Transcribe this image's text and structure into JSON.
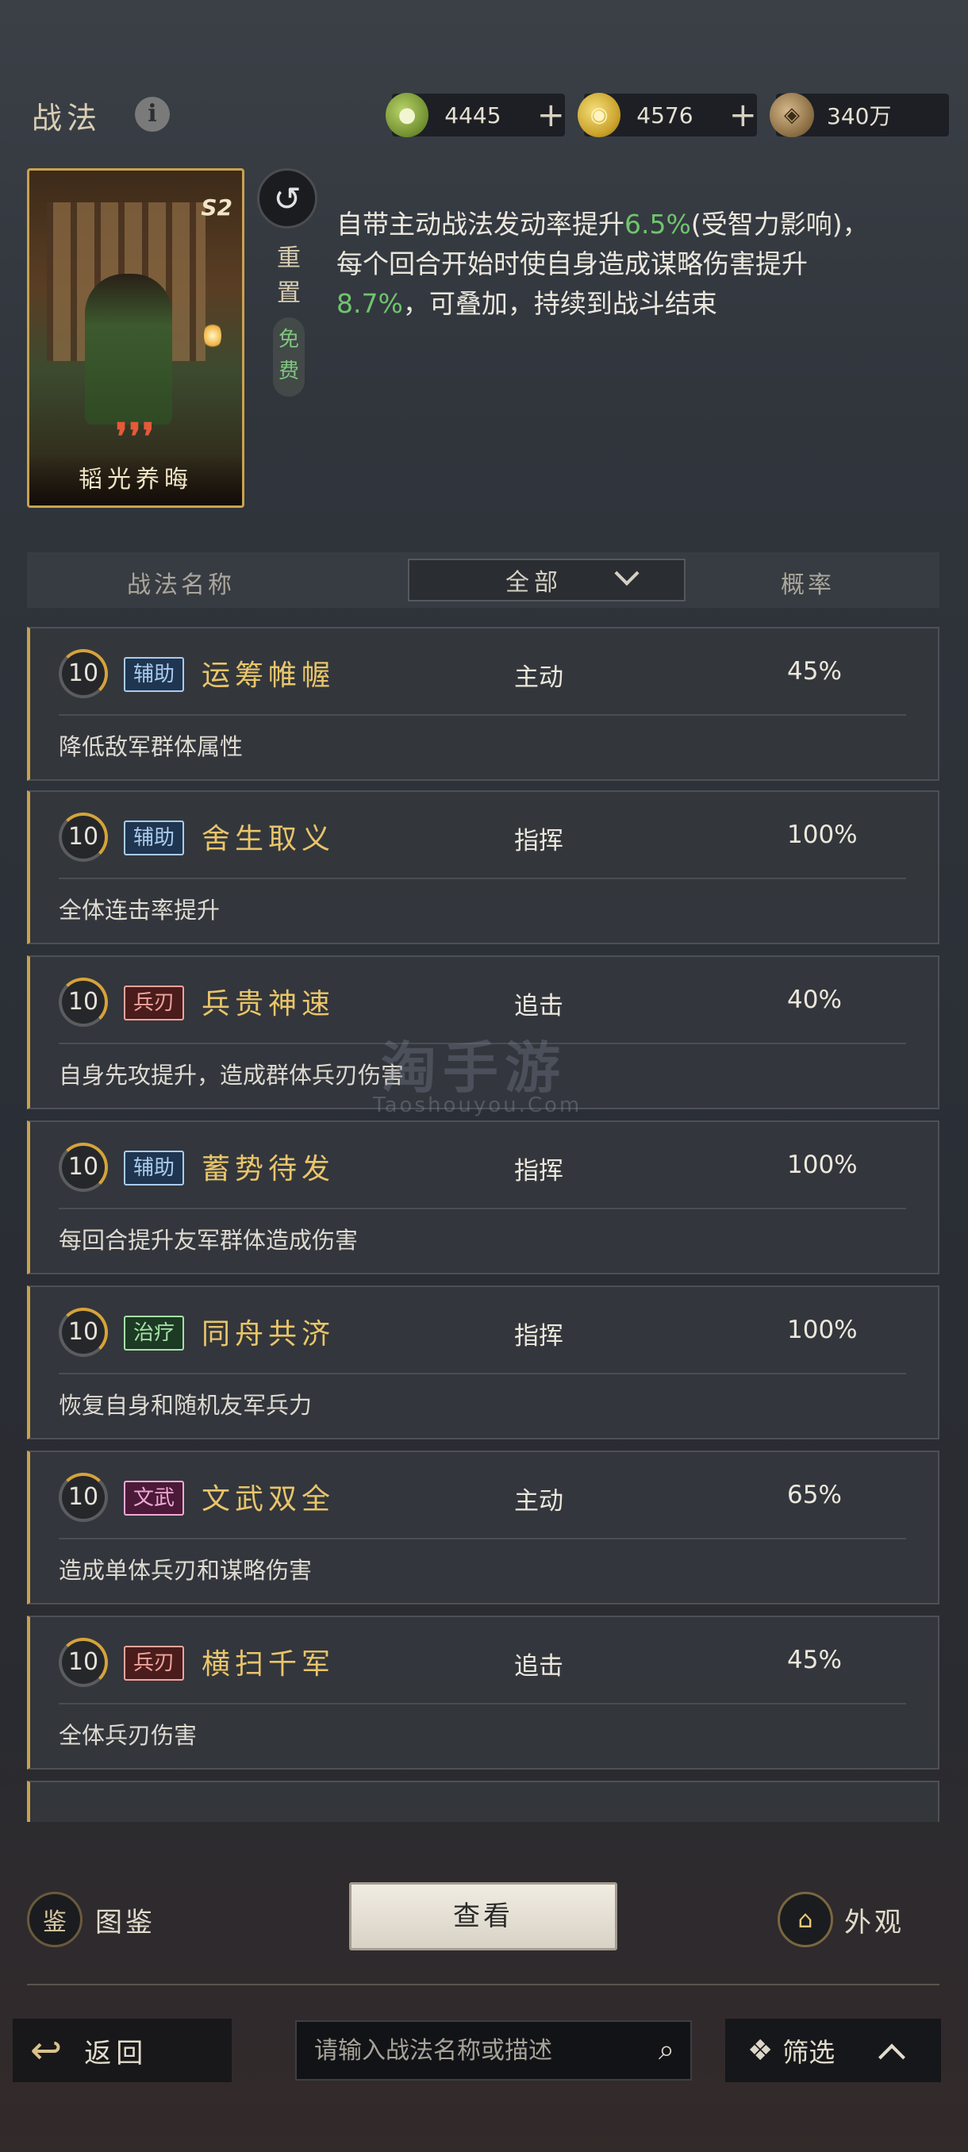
{
  "header": {
    "title": "战法",
    "info_icon": "i",
    "currencies": [
      {
        "name": "jade",
        "icon": "jade-coin-icon",
        "value": "4445"
      },
      {
        "name": "gold",
        "icon": "gold-coin-icon",
        "value": "4576"
      },
      {
        "name": "copper",
        "icon": "copper-coin-icon",
        "value": "340万"
      }
    ],
    "plus_label": "+"
  },
  "selected": {
    "card_name": "韬光养晦",
    "season_badge": "S2",
    "grade_marks": "❜❜❜",
    "reset_label": "重置",
    "free_label": "免费",
    "desc_part1": "自带主动战法发动率提升",
    "desc_value1": "6.5%",
    "desc_part2": "(受智力影响)，每个回合开始时使自身造成谋略伤害提升",
    "desc_value2": "8.7%",
    "desc_part3": "，可叠加，持续到战斗结束"
  },
  "filter": {
    "col_name": "战法名称",
    "dropdown_value": "全部",
    "col_rate": "概率"
  },
  "skills": [
    {
      "level": "10",
      "tag": "辅助",
      "tag_type": "assist",
      "name": "运筹帷幄",
      "type": "主动",
      "rate": "45%",
      "desc": "降低敌军群体属性"
    },
    {
      "level": "10",
      "tag": "辅助",
      "tag_type": "assist",
      "name": "舍生取义",
      "type": "指挥",
      "rate": "100%",
      "desc": "全体连击率提升"
    },
    {
      "level": "10",
      "tag": "兵刃",
      "tag_type": "blade",
      "name": "兵贵神速",
      "type": "追击",
      "rate": "40%",
      "desc": "自身先攻提升，造成群体兵刃伤害"
    },
    {
      "level": "10",
      "tag": "辅助",
      "tag_type": "assist",
      "name": "蓄势待发",
      "type": "指挥",
      "rate": "100%",
      "desc": "每回合提升友军群体造成伤害"
    },
    {
      "level": "10",
      "tag": "治疗",
      "tag_type": "heal",
      "name": "同舟共济",
      "type": "指挥",
      "rate": "100%",
      "desc": "恢复自身和随机友军兵力"
    },
    {
      "level": "10",
      "tag": "文武",
      "tag_type": "civil",
      "name": "文武双全",
      "type": "主动",
      "rate": "65%",
      "desc": "造成单体兵刃和谋略伤害"
    },
    {
      "level": "10",
      "tag": "兵刃",
      "tag_type": "blade",
      "name": "横扫千军",
      "type": "追击",
      "rate": "45%",
      "desc": "全体兵刃伤害"
    }
  ],
  "watermark": {
    "main": "淘手游",
    "sub": "Taoshouyou.Com"
  },
  "actions": {
    "book_label": "图鉴",
    "view_label": "查看",
    "appearance_label": "外观"
  },
  "footer": {
    "back_label": "返回",
    "search_placeholder": "请输入战法名称或描述",
    "filter_label": "筛选"
  },
  "colors": {
    "accent_gold": "#c9a24e",
    "skill_name": "#e9c56a",
    "highlight_green": "#6fc56d"
  }
}
